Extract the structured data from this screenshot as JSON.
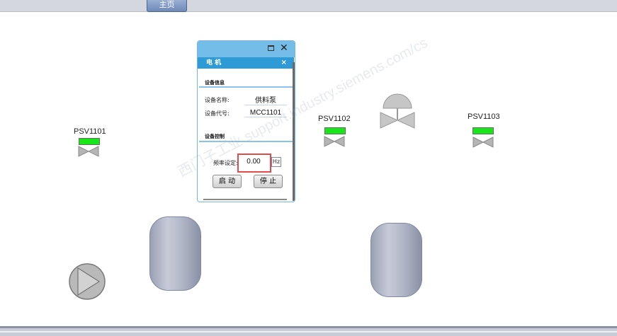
{
  "topbar": {
    "home_label": "主页"
  },
  "valves": [
    {
      "tag": "PSV1101",
      "status_color": "#19e619"
    },
    {
      "tag": "PSV1102",
      "status_color": "#19e619"
    },
    {
      "tag": "PSV1103",
      "status_color": "#19e619"
    }
  ],
  "popup": {
    "title": "电 机",
    "close_glyph": "×",
    "section_info": "设备信息",
    "name_label": "设备名称:",
    "name_value": "供料泵",
    "code_label": "设备代号:",
    "code_value": "MCC1101",
    "section_control": "设备控制",
    "freq_label": "频率设定:",
    "freq_value": "0.00",
    "freq_unit": "Hz",
    "start_label": "启 动",
    "stop_label": "停 止"
  },
  "watermark": "西门子工业 support.industry.siemens.com/cs",
  "colors": {
    "popup_header": "#2e9bd6",
    "popup_titlebar": "#74bde8",
    "highlight": "#e24b4b"
  }
}
